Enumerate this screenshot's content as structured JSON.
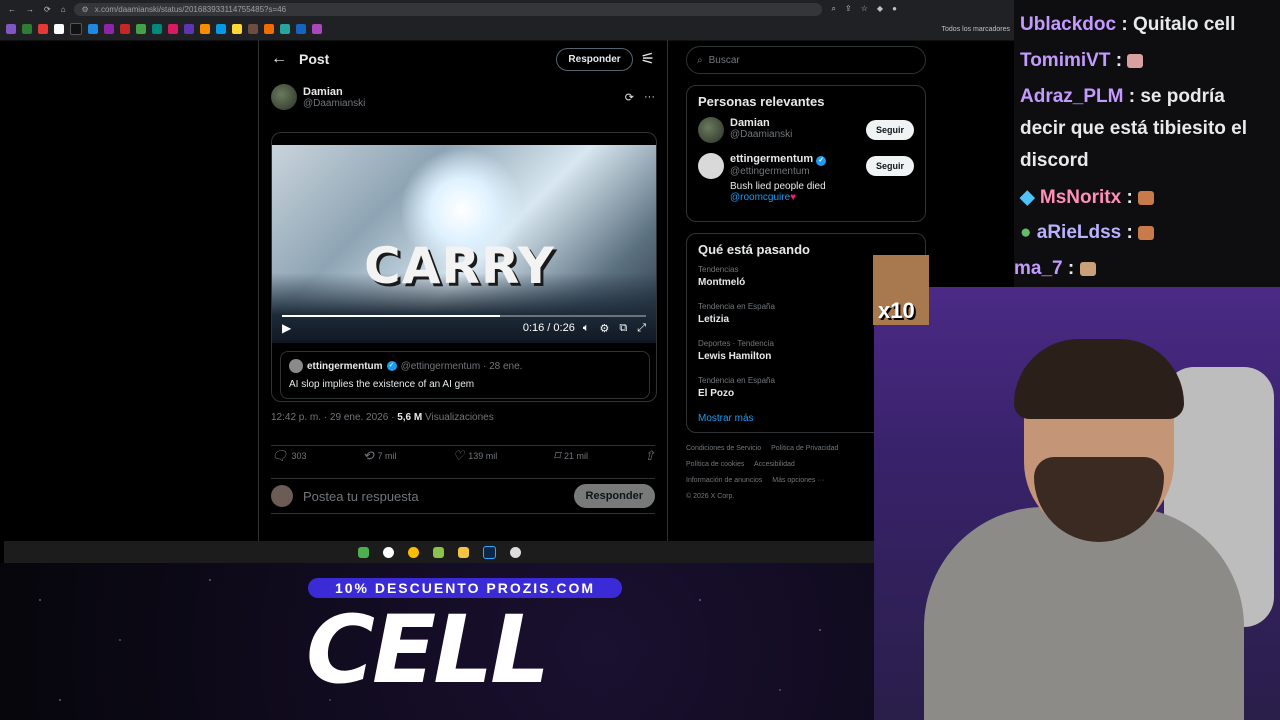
{
  "browser": {
    "url": "x.com/daamianski/status/201683933114755485?s=46",
    "bookmarks_folder": "Todos los marcadores"
  },
  "post": {
    "header_title": "Post",
    "respond_button": "Responder",
    "author_name": "Damian",
    "author_handle": "@Daamianski",
    "video_overlay_text": "CARRY",
    "video_time": "0:16 / 0:26",
    "video_progress": 0.6,
    "quote_name": "ettingermentum",
    "quote_handle_date": "@ettingermentum · 28 ene.",
    "quote_text": "AI slop implies the existence of an AI gem",
    "timestamp": "12:42 p. m. · 29 ene. 2026 ·",
    "views_count": "5,6 M",
    "views_label": "Visualizaciones",
    "replies": "303",
    "reposts": "7 mil",
    "likes": "139 mil",
    "bookmarks": "21 mil",
    "reply_placeholder": "Postea tu respuesta",
    "reply_button": "Responder"
  },
  "sidebar": {
    "search_placeholder": "Buscar",
    "relevant_title": "Personas relevantes",
    "people": [
      {
        "name": "Damian",
        "handle": "@Daamianski",
        "follow": "Seguir"
      },
      {
        "name": "ettingermentum",
        "handle": "@ettingermentum",
        "follow": "Seguir",
        "bio": "Bush lied people died",
        "bio_link": "@roomcguire"
      }
    ],
    "trending_title": "Qué está pasando",
    "trends": [
      {
        "category": "Tendencias",
        "topic": "Montmeló"
      },
      {
        "category": "Tendencia en España",
        "topic": "Letizia"
      },
      {
        "category": "Deportes · Tendencia",
        "topic": "Lewis Hamilton"
      },
      {
        "category": "Tendencia en España",
        "topic": "El Pozo"
      }
    ],
    "show_more": "Mostrar más",
    "footer": [
      "Condiciones de Servicio",
      "Política de Privacidad",
      "Política de cookies",
      "Accesibilidad",
      "Información de anuncios",
      "Más opciones ···",
      "© 2026 X Corp."
    ]
  },
  "chat": [
    {
      "user": "Ublackdoc",
      "text": ": Quitalo cell",
      "color": "#c39bff"
    },
    {
      "user": "TomimiVT",
      "text": ":",
      "color": "#c39bff"
    },
    {
      "user": "Adraz_PLM",
      "text": ": se podría",
      "color": "#c39bff"
    },
    {
      "user": "",
      "text": "decir que está tibiesito el",
      "color": "#ffffff"
    },
    {
      "user": "",
      "text": "discord",
      "color": "#ffffff"
    },
    {
      "user": "MsNoritx",
      "text": ":",
      "color": "#ff8fb5"
    },
    {
      "user": "aRieLdss",
      "text": ":",
      "color": "#b9b2ff"
    },
    {
      "user": "ma_7",
      "text": ":",
      "color": "#c39bff"
    }
  ],
  "overlay": {
    "meme_text": "x10",
    "promo_code": "10% DESCUENTO PROZIS.COM",
    "promo_name": "CELL"
  }
}
